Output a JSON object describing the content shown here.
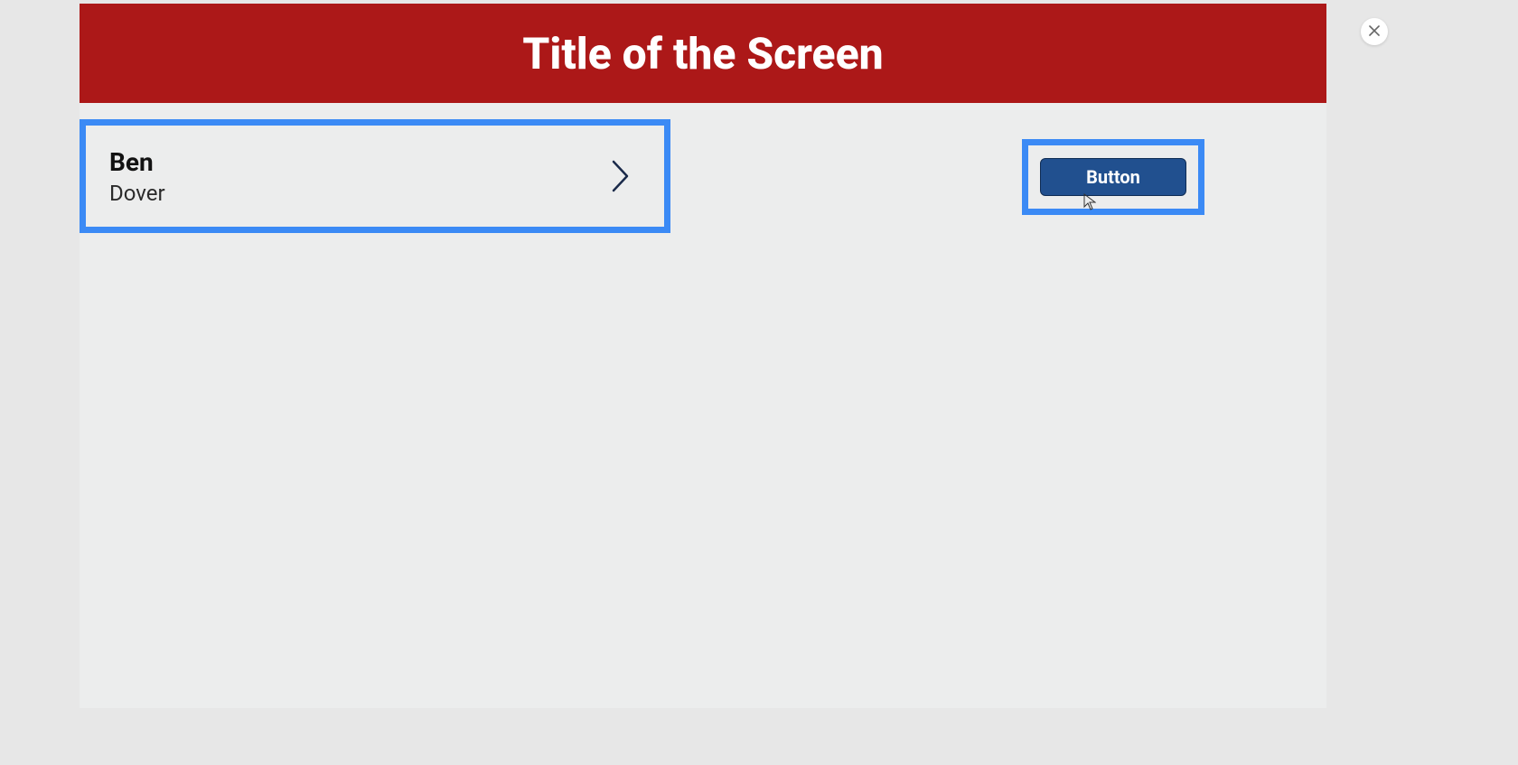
{
  "header": {
    "title": "Title of the Screen"
  },
  "list": {
    "items": [
      {
        "primary": "Ben",
        "secondary": "Dover"
      }
    ]
  },
  "actions": {
    "primary_button_label": "Button"
  },
  "colors": {
    "header_bg": "#ac1818",
    "highlight_border": "#3b8af5",
    "button_bg": "#21508f"
  }
}
